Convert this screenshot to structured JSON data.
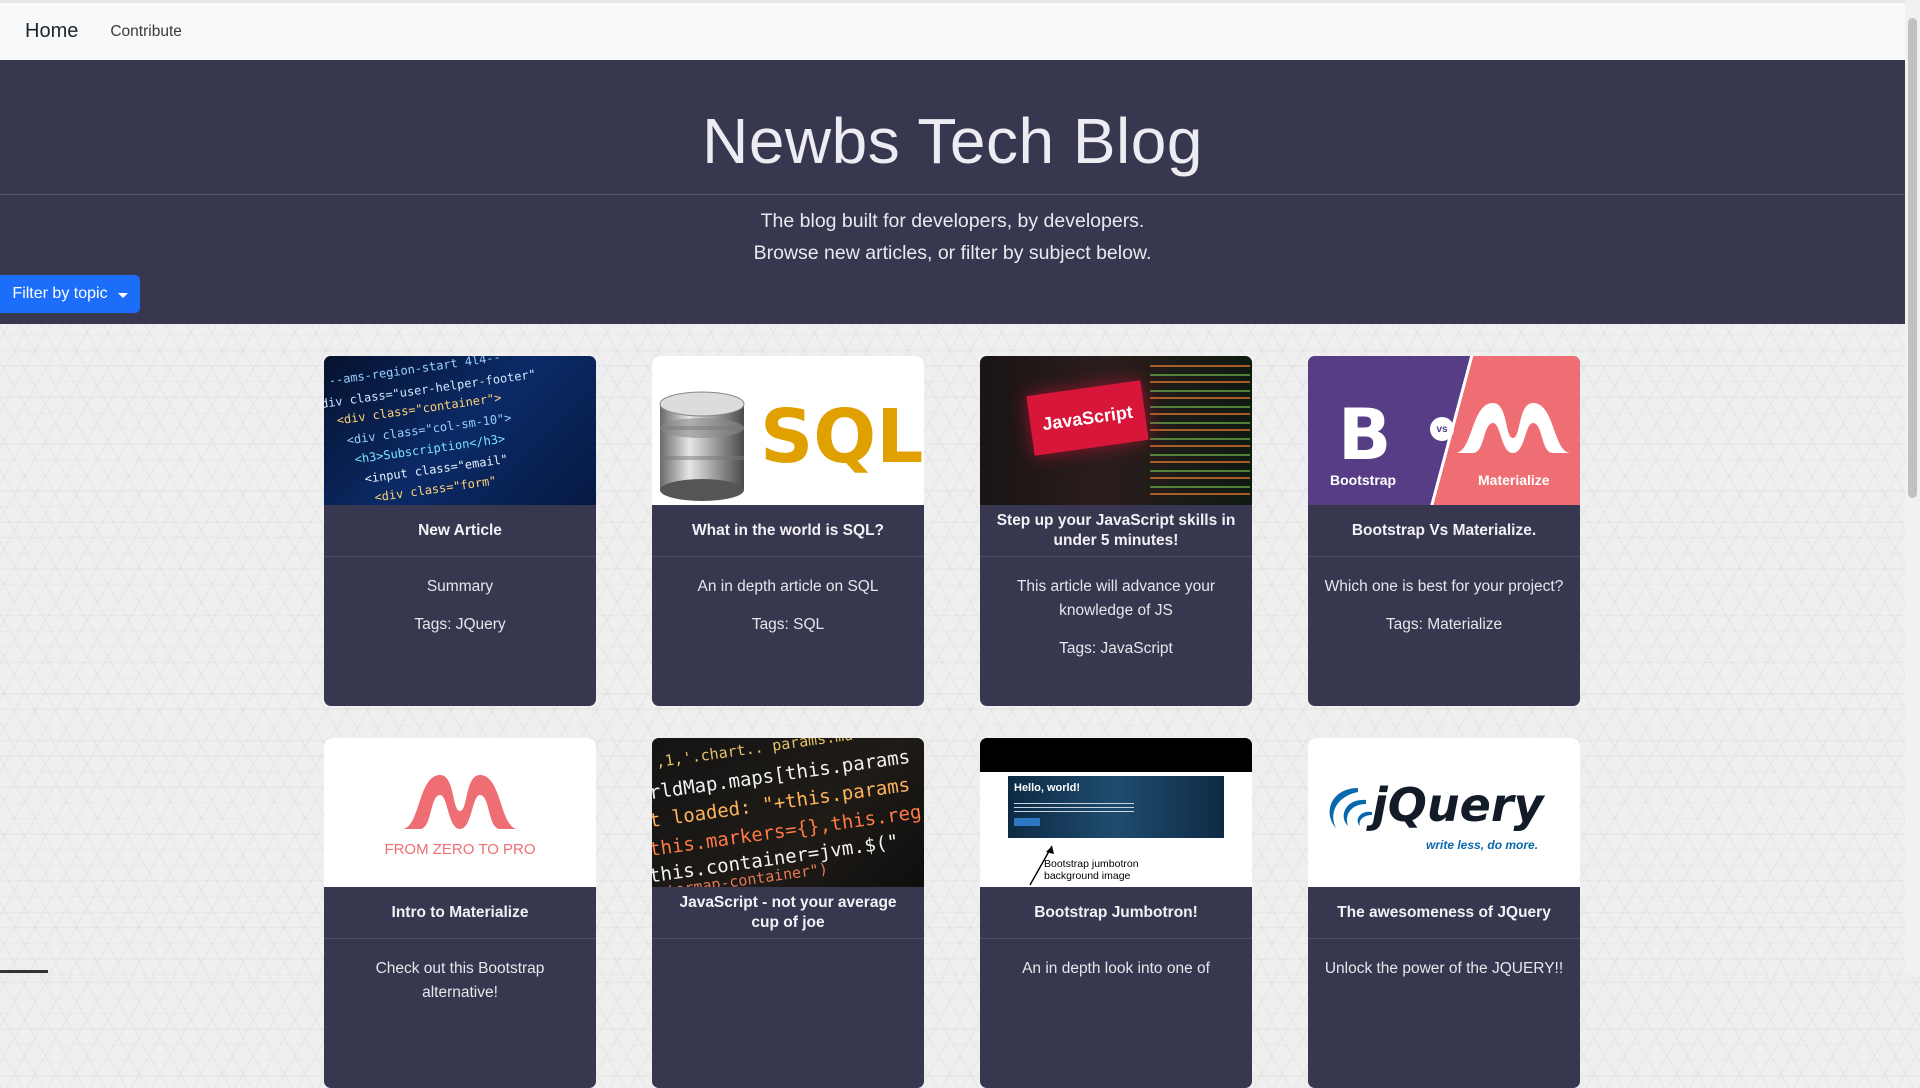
{
  "navbar": {
    "brand": "Home",
    "links": [
      "Contribute"
    ]
  },
  "hero": {
    "title": "Newbs Tech Blog",
    "line1": "The blog built for developers, by developers.",
    "line2": "Browse new articles, or filter by subject below.",
    "filter_button": "Filter by topic"
  },
  "cards": [
    {
      "title": "New Article",
      "summary": "Summary",
      "tags": "Tags: JQuery"
    },
    {
      "title": "What in the world is SQL?",
      "summary": "An in depth article on SQL",
      "tags": "Tags: SQL",
      "image_text": "SQL"
    },
    {
      "title": "Step up your JavaScript skills in under 5 minutes!",
      "summary": "This article will advance your knowledge of JS",
      "tags": "Tags: JavaScript",
      "image_text": "JavaScript"
    },
    {
      "title": "Bootstrap Vs Materialize.",
      "summary": "Which one is best for your project?",
      "tags": "Tags: Materialize",
      "image_text": {
        "left": "Bootstrap",
        "vs": "vs",
        "right": "Materialize"
      }
    },
    {
      "title": "Intro to Materialize",
      "summary": "Check out this Bootstrap alternative!",
      "image_text": "FROM ZERO TO PRO"
    },
    {
      "title": "JavaScript - not your average cup of joe"
    },
    {
      "title": "Bootstrap Jumbotron!",
      "summary": "An in depth look into one of",
      "image_text": {
        "hello": "Hello, world!",
        "caption": "Bootstrap jumbotron background image"
      }
    },
    {
      "title": "The awesomeness of JQuery",
      "summary": "Unlock the power of the JQUERY!!",
      "image_text": {
        "logo": "jQuery",
        "tagline": "write less, do more."
      }
    }
  ],
  "colors": {
    "hero_bg": "#37374f",
    "card_bg": "#37374f",
    "button": "#1c6dfa"
  }
}
